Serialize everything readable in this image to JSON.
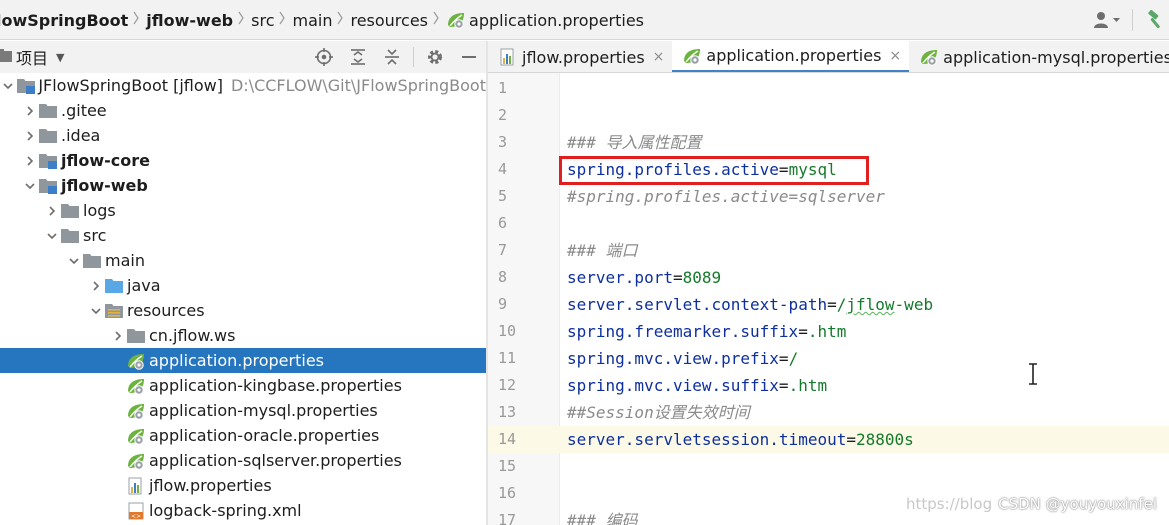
{
  "breadcrumb": [
    {
      "label": "lowSpringBoot",
      "bold": true,
      "icon": null
    },
    {
      "label": "jflow-web",
      "bold": true,
      "icon": null
    },
    {
      "label": "src",
      "bold": false,
      "icon": null
    },
    {
      "label": "main",
      "bold": false,
      "icon": null
    },
    {
      "label": "resources",
      "bold": false,
      "icon": null
    },
    {
      "label": "application.properties",
      "bold": false,
      "icon": "spring-properties-icon"
    }
  ],
  "project_panel": {
    "title": "项目"
  },
  "tree": [
    {
      "label": "JFlowSpringBoot [jflow]",
      "bold": false,
      "path": "D:\\CCFLOW\\Git\\JFlowSpringBoot",
      "depth": 0,
      "arrow": "down",
      "icon": "module-folder-icon"
    },
    {
      "label": ".gitee",
      "bold": false,
      "depth": 1,
      "arrow": "right",
      "icon": "folder-icon"
    },
    {
      "label": ".idea",
      "bold": false,
      "depth": 1,
      "arrow": "right",
      "icon": "folder-icon"
    },
    {
      "label": "jflow-core",
      "bold": true,
      "depth": 1,
      "arrow": "right",
      "icon": "module-folder-icon"
    },
    {
      "label": "jflow-web",
      "bold": true,
      "depth": 1,
      "arrow": "down",
      "icon": "module-folder-icon"
    },
    {
      "label": "logs",
      "bold": false,
      "depth": 2,
      "arrow": "right",
      "icon": "folder-icon"
    },
    {
      "label": "src",
      "bold": false,
      "depth": 2,
      "arrow": "down",
      "icon": "folder-icon"
    },
    {
      "label": "main",
      "bold": false,
      "depth": 3,
      "arrow": "down",
      "icon": "folder-icon"
    },
    {
      "label": "java",
      "bold": false,
      "depth": 4,
      "arrow": "right",
      "icon": "source-folder-icon"
    },
    {
      "label": "resources",
      "bold": false,
      "depth": 4,
      "arrow": "down",
      "icon": "resources-folder-icon"
    },
    {
      "label": "cn.jflow.ws",
      "bold": false,
      "depth": 5,
      "arrow": "right",
      "icon": "folder-icon"
    },
    {
      "label": "application.properties",
      "bold": false,
      "depth": 5,
      "arrow": "none",
      "icon": "spring-properties-icon",
      "selected": true
    },
    {
      "label": "application-kingbase.properties",
      "bold": false,
      "depth": 5,
      "arrow": "none",
      "icon": "spring-properties-icon"
    },
    {
      "label": "application-mysql.properties",
      "bold": false,
      "depth": 5,
      "arrow": "none",
      "icon": "spring-properties-icon"
    },
    {
      "label": "application-oracle.properties",
      "bold": false,
      "depth": 5,
      "arrow": "none",
      "icon": "spring-properties-icon"
    },
    {
      "label": "application-sqlserver.properties",
      "bold": false,
      "depth": 5,
      "arrow": "none",
      "icon": "spring-properties-icon"
    },
    {
      "label": "jflow.properties",
      "bold": false,
      "depth": 5,
      "arrow": "none",
      "icon": "properties-file-icon"
    },
    {
      "label": "logback-spring.xml",
      "bold": false,
      "depth": 5,
      "arrow": "none",
      "icon": "xml-file-icon"
    }
  ],
  "editor_tabs": [
    {
      "label": "jflow.properties",
      "icon": "properties-file-icon",
      "active": false
    },
    {
      "label": "application.properties",
      "icon": "spring-properties-icon",
      "active": true
    },
    {
      "label": "application-mysql.properties",
      "icon": "spring-properties-icon",
      "active": false
    }
  ],
  "code_lines": [
    {
      "n": "1",
      "parts": []
    },
    {
      "n": "2",
      "parts": []
    },
    {
      "n": "3",
      "parts": [
        {
          "t": "### 导入属性配置",
          "c": "c"
        }
      ]
    },
    {
      "n": "4",
      "parts": [
        {
          "t": "spring.profiles.active",
          "c": "k"
        },
        {
          "t": "=",
          "c": "eq"
        },
        {
          "t": "mysql",
          "c": "v"
        }
      ]
    },
    {
      "n": "5",
      "parts": [
        {
          "t": "#spring.profiles.active=sqlserver",
          "c": "c"
        }
      ]
    },
    {
      "n": "6",
      "parts": []
    },
    {
      "n": "7",
      "parts": [
        {
          "t": "### 端口",
          "c": "c"
        }
      ]
    },
    {
      "n": "8",
      "parts": [
        {
          "t": "server.port",
          "c": "k"
        },
        {
          "t": "=",
          "c": "eq"
        },
        {
          "t": "8089",
          "c": "v"
        }
      ]
    },
    {
      "n": "9",
      "parts": [
        {
          "t": "server.servlet.context-path",
          "c": "k"
        },
        {
          "t": "=",
          "c": "eq"
        },
        {
          "t": "/",
          "c": "v"
        },
        {
          "t": "jflow",
          "c": "v underline"
        },
        {
          "t": "-web",
          "c": "v"
        }
      ]
    },
    {
      "n": "10",
      "parts": [
        {
          "t": "spring.freemarker.suffix",
          "c": "k"
        },
        {
          "t": "=",
          "c": "eq"
        },
        {
          "t": ".htm",
          "c": "v"
        }
      ]
    },
    {
      "n": "11",
      "parts": [
        {
          "t": "spring.mvc.view.prefix",
          "c": "k"
        },
        {
          "t": "=",
          "c": "eq"
        },
        {
          "t": "/",
          "c": "v"
        }
      ]
    },
    {
      "n": "12",
      "parts": [
        {
          "t": "spring.mvc.view.suffix",
          "c": "k"
        },
        {
          "t": "=",
          "c": "eq"
        },
        {
          "t": ".htm",
          "c": "v"
        }
      ]
    },
    {
      "n": "13",
      "parts": [
        {
          "t": "##Session设置失效时间",
          "c": "c"
        }
      ]
    },
    {
      "n": "14",
      "parts": [
        {
          "t": "server.servletsession.timeout",
          "c": "k"
        },
        {
          "t": "=",
          "c": "eq"
        },
        {
          "t": "28800s",
          "c": "v"
        }
      ],
      "current": true
    },
    {
      "n": "15",
      "parts": []
    },
    {
      "n": "16",
      "parts": []
    },
    {
      "n": "17",
      "parts": [
        {
          "t": "### 编码",
          "c": "c"
        }
      ]
    }
  ],
  "watermark": {
    "faint": "https://blog",
    "text": "CSDN @youyouxinfei"
  },
  "colors": {
    "selection": "#2675bf",
    "highlight_box": "#e01f1f",
    "key": "#0e2f9e",
    "value": "#157a2a",
    "comment": "#8a8a8a"
  }
}
